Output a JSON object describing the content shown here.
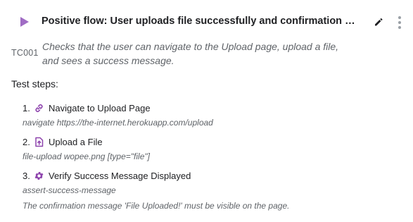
{
  "header": {
    "title": "Positive flow: User uploads file successfully and confirmation message is displayed",
    "play_icon": "play-icon",
    "edit_icon": "pencil-icon",
    "more_icon": "more-vertical-icon"
  },
  "test_case": {
    "id": "TC001",
    "description": "Checks that the user can navigate to the Upload page, upload a file, and sees a success message."
  },
  "steps_heading": "Test steps:",
  "steps": [
    {
      "number": "1.",
      "icon": "link-icon",
      "label": "Navigate to Upload Page",
      "detail": "navigate https://the-internet.herokuapp.com/upload"
    },
    {
      "number": "2.",
      "icon": "file-upload-icon",
      "label": "Upload a File",
      "detail": "file-upload wopee.png [type=\"file\"]"
    },
    {
      "number": "3.",
      "icon": "gear-icon",
      "label": "Verify Success Message Displayed",
      "detail": "assert-success-message"
    }
  ],
  "note": "The confirmation message 'File Uploaded!' must be visible on the page.",
  "colors": {
    "accent": "#8e44ad",
    "text": "#202124",
    "muted": "#5f6368"
  }
}
